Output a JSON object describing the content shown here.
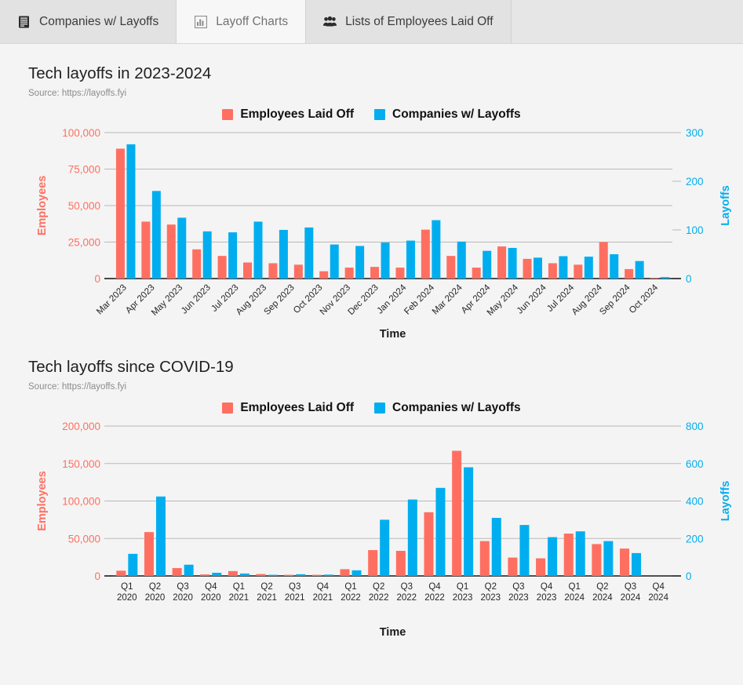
{
  "tabs": [
    {
      "label": "Companies w/ Layoffs",
      "icon": "list-document-icon",
      "active": false
    },
    {
      "label": "Layoff Charts",
      "icon": "bar-chart-icon",
      "active": true
    },
    {
      "label": "Lists of Employees Laid Off",
      "icon": "people-group-icon",
      "active": false
    }
  ],
  "colors": {
    "employees": "#FF6F61",
    "companies": "#00AEEF",
    "page_bg": "#f4f4f4",
    "grid": "#b9b9b9",
    "axis": "#1a1a1a"
  },
  "legend": {
    "employees_label": "Employees Laid Off",
    "companies_label": "Companies w/ Layoffs"
  },
  "chart_data": [
    {
      "type": "bar",
      "title": "Tech layoffs in 2023-2024",
      "subtitle": "Source: https://layoffs.fyi",
      "xlabel": "Time",
      "ylabel": "Employees",
      "y2label": "Layoffs",
      "ylim": [
        0,
        100000
      ],
      "y2lim": [
        0,
        300
      ],
      "yticks": [
        "0",
        "25,000",
        "50,000",
        "75,000",
        "100,000"
      ],
      "ytick_values": [
        0,
        25000,
        50000,
        75000,
        100000
      ],
      "y2ticks": [
        "0",
        "100",
        "200",
        "300"
      ],
      "y2tick_values": [
        0,
        100,
        200,
        300
      ],
      "grid": true,
      "legend_position": "top-center",
      "categories": [
        "Mar 2023",
        "Apr 2023",
        "May 2023",
        "Jun 2023",
        "Jul 2023",
        "Aug 2023",
        "Sep 2023",
        "Oct 2023",
        "Nov 2023",
        "Dec 2023",
        "Jan 2024",
        "Feb 2024",
        "Mar 2024",
        "Apr 2024",
        "May 2024",
        "Jun 2024",
        "Jul 2024",
        "Aug 2024",
        "Sep 2024",
        "Oct 2024"
      ],
      "series": [
        {
          "name": "Employees Laid Off",
          "axis": "left",
          "values": [
            89000,
            39000,
            37000,
            20000,
            15500,
            11000,
            10500,
            9500,
            5000,
            7500,
            8000,
            7500,
            33500,
            15500,
            7500,
            22000,
            13500,
            10500,
            9500,
            25000,
            6500,
            300
          ]
        },
        {
          "name": "Companies w/ Layoffs",
          "axis": "right",
          "values": [
            276,
            180,
            125,
            97,
            95,
            117,
            100,
            105,
            70,
            67,
            74,
            78,
            120,
            76,
            57,
            63,
            43,
            46,
            45,
            50,
            36,
            3
          ]
        }
      ],
      "notes": "20 x-tick labels (Mar 2023 - Oct 2024) over 22 bar groups"
    },
    {
      "type": "bar",
      "title": "Tech layoffs since COVID-19",
      "subtitle": "Source: https://layoffs.fyi",
      "xlabel": "Time",
      "ylabel": "Employees",
      "y2label": "Layoffs",
      "ylim": [
        0,
        200000
      ],
      "y2lim": [
        0,
        800
      ],
      "yticks": [
        "0",
        "50,000",
        "100,000",
        "150,000",
        "200,000"
      ],
      "ytick_values": [
        0,
        50000,
        100000,
        150000,
        200000
      ],
      "y2ticks": [
        "0",
        "200",
        "400",
        "600",
        "800"
      ],
      "y2tick_values": [
        0,
        200,
        400,
        600,
        800
      ],
      "grid": true,
      "legend_position": "top-center",
      "categories": [
        "Q1\n2020",
        "Q2\n2020",
        "Q3\n2020",
        "Q4\n2020",
        "Q1\n2021",
        "Q2\n2021",
        "Q3\n2021",
        "Q4\n2021",
        "Q1\n2022",
        "Q2\n2022",
        "Q3\n2022",
        "Q4\n2022",
        "Q1\n2023",
        "Q2\n2023",
        "Q3\n2023",
        "Q4\n2023",
        "Q1\n2024",
        "Q2\n2024",
        "Q3\n2024",
        "Q4\n2024"
      ],
      "series": [
        {
          "name": "Employees Laid Off",
          "axis": "left",
          "values": [
            7000,
            58500,
            10500,
            2000,
            6500,
            2500,
            1500,
            1500,
            9000,
            34500,
            33500,
            85000,
            167000,
            46500,
            24500,
            23500,
            56500,
            42500,
            36500,
            0
          ]
        },
        {
          "name": "Companies w/ Layoffs",
          "axis": "right",
          "values": [
            118,
            424,
            60,
            17,
            13,
            6,
            9,
            7,
            30,
            300,
            408,
            470,
            580,
            310,
            272,
            207,
            238,
            186,
            122,
            0
          ]
        }
      ]
    }
  ]
}
